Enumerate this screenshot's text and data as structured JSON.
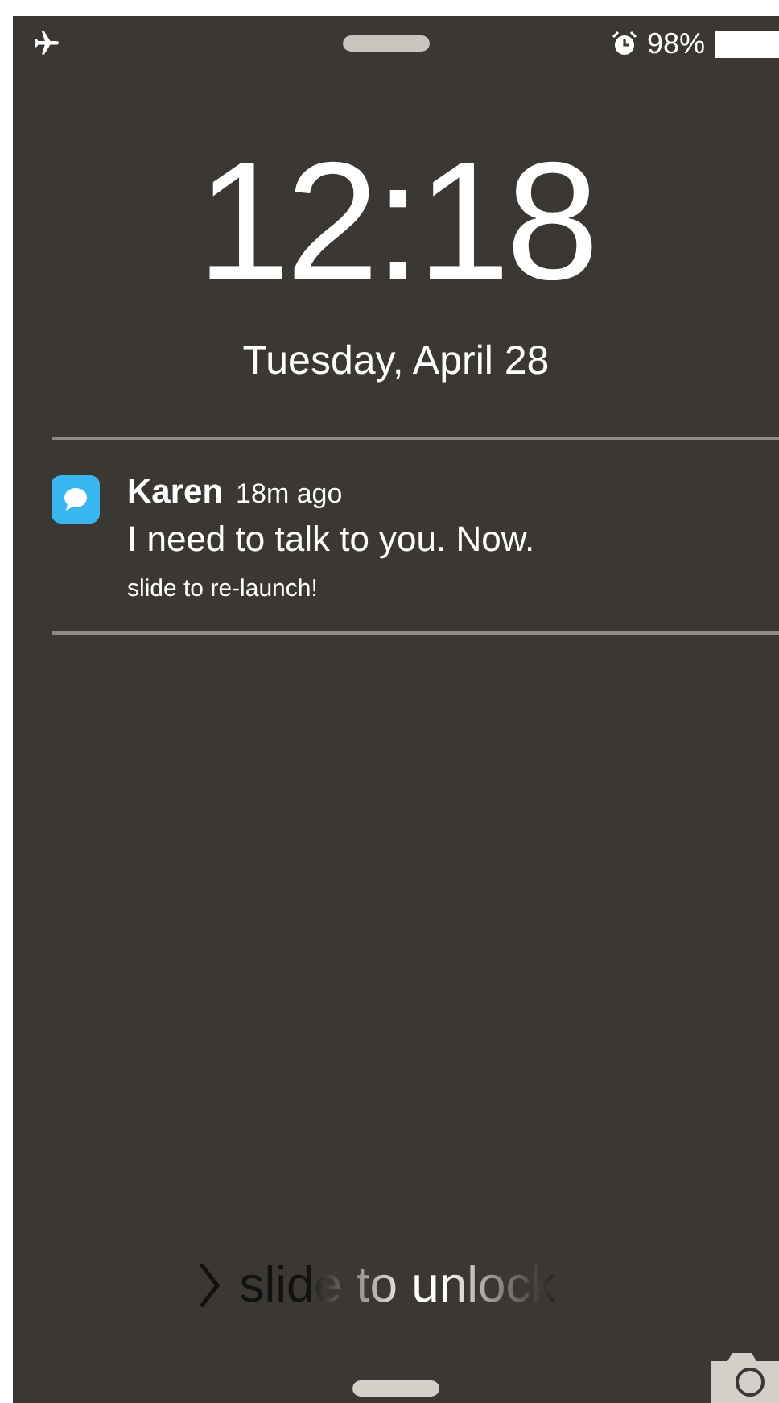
{
  "status_bar": {
    "battery_text": "98%"
  },
  "clock": {
    "time": "12:18",
    "date": "Tuesday, April 28"
  },
  "notifications": [
    {
      "sender": "Karen",
      "time": "18m ago",
      "message": "I need to talk to you. Now.",
      "action_hint": "slide to re-launch!"
    }
  ],
  "unlock": {
    "label": "slide to unlock"
  }
}
